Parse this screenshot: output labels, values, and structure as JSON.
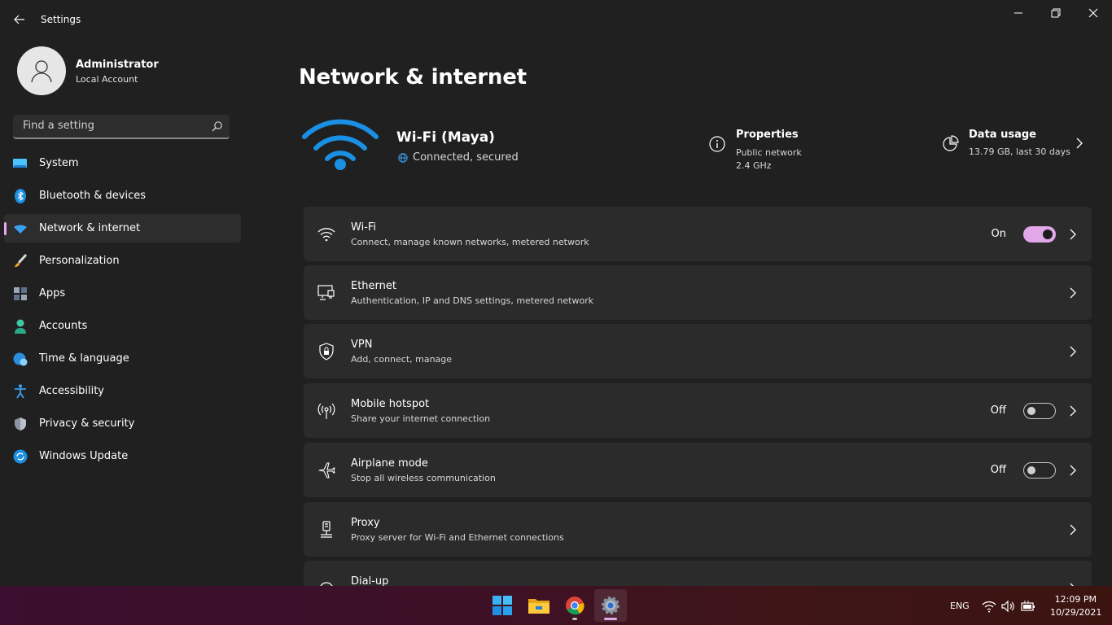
{
  "window": {
    "title": "Settings"
  },
  "account": {
    "name": "Administrator",
    "type": "Local Account"
  },
  "search": {
    "placeholder": "Find a setting"
  },
  "nav": {
    "items": [
      {
        "label": "System",
        "icon": "monitor-icon"
      },
      {
        "label": "Bluetooth & devices",
        "icon": "bluetooth-icon"
      },
      {
        "label": "Network & internet",
        "icon": "wifi-icon",
        "selected": true
      },
      {
        "label": "Personalization",
        "icon": "brush-icon"
      },
      {
        "label": "Apps",
        "icon": "apps-icon"
      },
      {
        "label": "Accounts",
        "icon": "person-icon"
      },
      {
        "label": "Time & language",
        "icon": "globe-clock-icon"
      },
      {
        "label": "Accessibility",
        "icon": "accessibility-icon"
      },
      {
        "label": "Privacy & security",
        "icon": "shield-icon"
      },
      {
        "label": "Windows Update",
        "icon": "update-icon"
      }
    ]
  },
  "main": {
    "title": "Network & internet",
    "connection": {
      "name": "Wi-Fi (Maya)",
      "status": "Connected, secured"
    },
    "properties": {
      "title": "Properties",
      "line1": "Public network",
      "line2": "2.4 GHz"
    },
    "data_usage": {
      "title": "Data usage",
      "sub": "13.79 GB, last 30 days"
    },
    "cards": [
      {
        "title": "Wi-Fi",
        "sub": "Connect, manage known networks, metered network",
        "state": "On",
        "icon": "wifi-icon"
      },
      {
        "title": "Ethernet",
        "sub": "Authentication, IP and DNS settings, metered network",
        "icon": "ethernet-icon"
      },
      {
        "title": "VPN",
        "sub": "Add, connect, manage",
        "icon": "vpn-shield-icon"
      },
      {
        "title": "Mobile hotspot",
        "sub": "Share your internet connection",
        "state": "Off",
        "icon": "hotspot-icon"
      },
      {
        "title": "Airplane mode",
        "sub": "Stop all wireless communication",
        "state": "Off",
        "icon": "airplane-icon"
      },
      {
        "title": "Proxy",
        "sub": "Proxy server for Wi-Fi and Ethernet connections",
        "icon": "proxy-icon"
      },
      {
        "title": "Dial-up",
        "sub": "",
        "icon": "dialup-icon"
      }
    ]
  },
  "taskbar": {
    "language": "ENG",
    "time": "12:09 PM",
    "date": "10/29/2021"
  },
  "colors": {
    "accent": "#e1a7e8",
    "background": "#202020",
    "card": "#2b2b2b"
  }
}
